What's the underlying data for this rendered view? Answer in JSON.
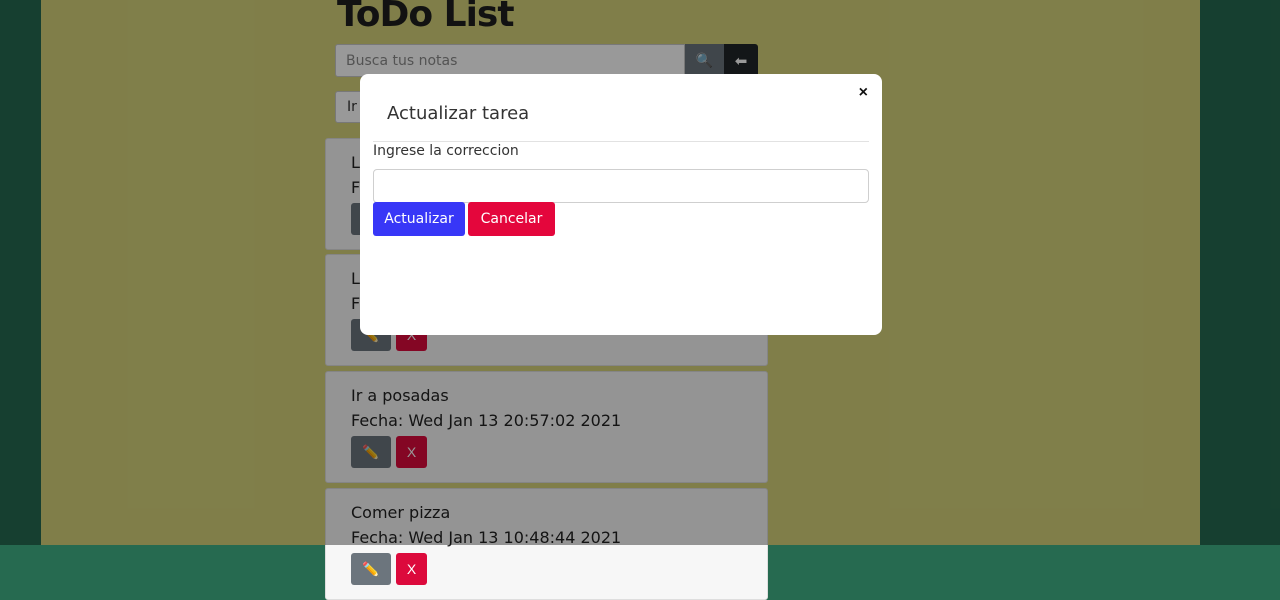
{
  "app": {
    "title": "ToDo List"
  },
  "search": {
    "placeholder": "Busca tus notas",
    "search_icon": "🔍",
    "back_icon": "⬅"
  },
  "filter": {
    "label": "Ir"
  },
  "notes": [
    {
      "title": "Lo",
      "date": "Fe"
    },
    {
      "title": "Lo",
      "date": "Fe"
    },
    {
      "title": "Ir a posadas",
      "date": "Fecha: Wed Jan 13 20:57:02 2021"
    },
    {
      "title": "Comer pizza",
      "date": "Fecha: Wed Jan 13 10:48:44 2021"
    }
  ],
  "note_actions": {
    "edit_icon": "✏️",
    "delete_label": "X"
  },
  "modal": {
    "close_label": "×",
    "title": "Actualizar tarea",
    "field_label": "Ingrese la correccion",
    "field_value": "",
    "update_label": "Actualizar",
    "cancel_label": "Cancelar"
  },
  "colors": {
    "outer_bg": "#266a50",
    "page_bg": "#d6d37b",
    "update_button": "#3837f7",
    "cancel_button": "#e4063c",
    "delete_button": "#dc0a3c"
  }
}
